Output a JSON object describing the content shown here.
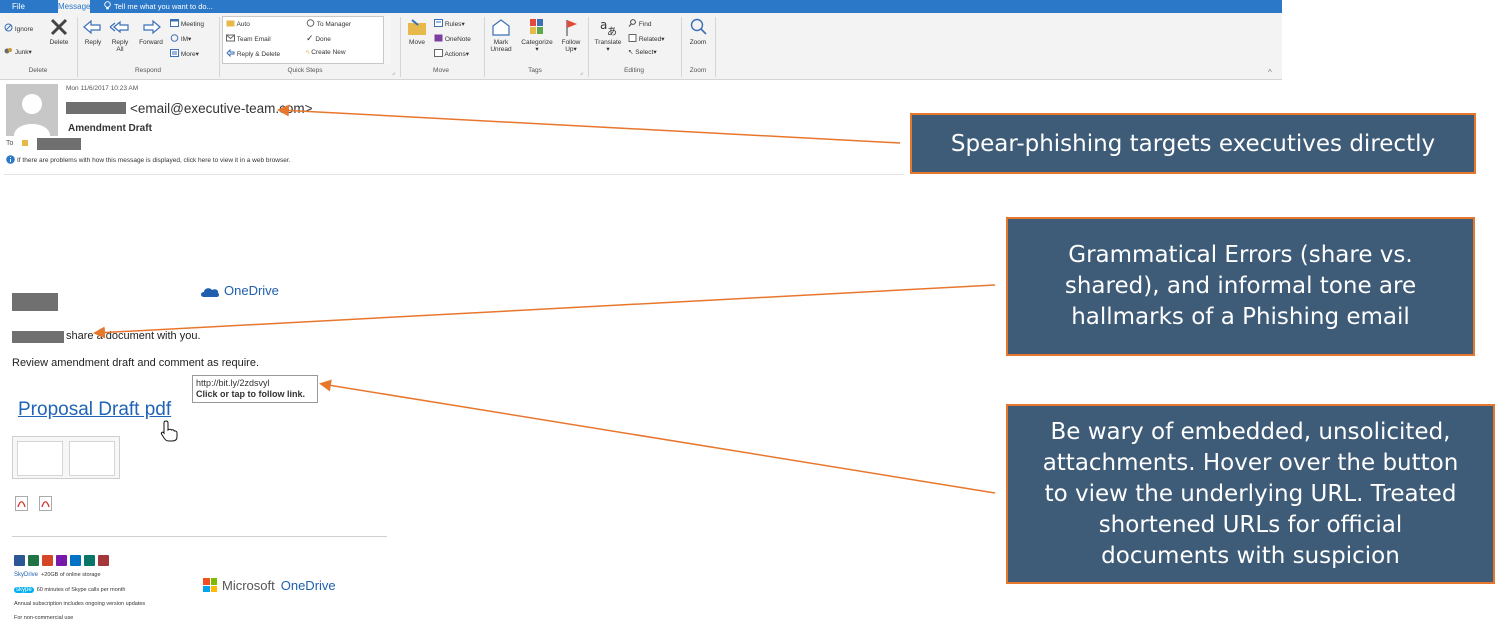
{
  "tabs": {
    "file": "File",
    "message": "Message",
    "tell_me": "Tell me what you want to do..."
  },
  "ribbon": {
    "delete_group": {
      "ignore": "Ignore",
      "junk": "Junk",
      "delete": "Delete",
      "label": "Delete"
    },
    "respond_group": {
      "reply": "Reply",
      "reply_all_1": "Reply",
      "reply_all_2": "All",
      "forward": "Forward",
      "meeting": "Meeting",
      "im": "IM",
      "more": "More",
      "label": "Respond"
    },
    "quick_steps": {
      "auto": "Auto",
      "team_email": "Team Email",
      "reply_delete": "Reply & Delete",
      "to_manager": "To Manager",
      "done": "Done",
      "create_new": "Create New",
      "label": "Quick Steps"
    },
    "move_group": {
      "move": "Move",
      "rules": "Rules",
      "onenote": "OneNote",
      "actions": "Actions",
      "label": "Move"
    },
    "tags_group": {
      "mark_1": "Mark",
      "mark_2": "Unread",
      "categorize": "Categorize",
      "follow_1": "Follow",
      "follow_2": "Up",
      "label": "Tags"
    },
    "editing_group": {
      "translate": "Translate",
      "find": "Find",
      "related": "Related",
      "select": "Select",
      "label": "Editing"
    },
    "zoom_group": {
      "zoom": "Zoom",
      "label": "Zoom"
    }
  },
  "header": {
    "date": "Mon 11/6/2017 10:23 AM",
    "sender_email": "<email@executive-team.com>",
    "subject": "Amendment Draft",
    "to_label": "To",
    "info_text": "If there are problems with how this message is displayed, click here to view it in a web browser."
  },
  "body": {
    "onedrive": "OneDrive",
    "share_text": "share a document with you.",
    "review_text": "Review amendment draft and comment as require.",
    "tooltip_url": "http://bit.ly/2zdsvyl",
    "tooltip_hint": "Click or tap to follow link.",
    "proposal_link": "Proposal Draft pdf",
    "promo_skydrive": "SkyDrive",
    "promo_storage": "+20GB of online storage",
    "promo_skype": "skype",
    "promo_skype_text": "60 minutes of Skype calls per month",
    "promo_annual": "Annual subscription includes ongoing version updates",
    "promo_noncommercial": "For non-commercial use",
    "microsoft": "Microsoft",
    "ms_onedrive": "OneDrive"
  },
  "callouts": {
    "c1": [
      "Spear-phishing targets executives directly"
    ],
    "c2": [
      "Grammatical Errors (share vs.",
      "shared), and informal tone are",
      "hallmarks of a Phishing email"
    ],
    "c3": [
      "Be wary of embedded, unsolicited,",
      "attachments. Hover over the button",
      "to view the underlying URL. Treated",
      "shortened URLs for official",
      "documents with suspicion"
    ]
  },
  "colors": {
    "ribbon_blue": "#2b78c8",
    "callout_fill": "#3e5b78",
    "callout_border": "#e8772e",
    "link": "#1f64b6",
    "arrow": "#e8772e"
  }
}
